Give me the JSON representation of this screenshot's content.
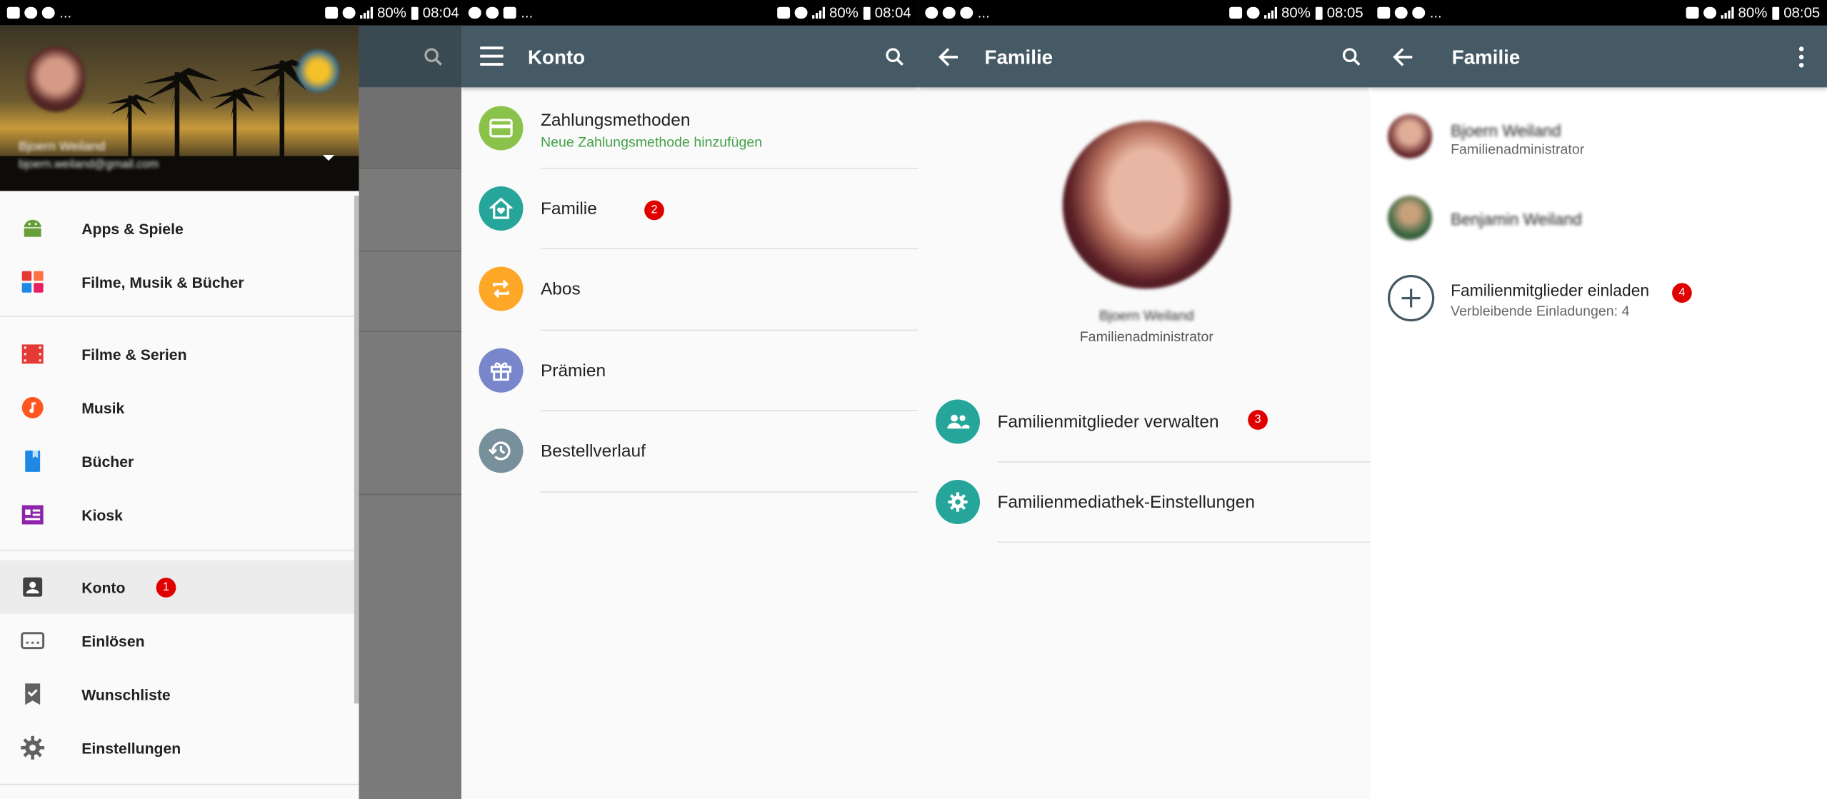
{
  "status_bars": [
    {
      "battery": "80%",
      "time": "08:04",
      "dots": "..."
    },
    {
      "battery": "80%",
      "time": "08:04",
      "dots": "..."
    },
    {
      "battery": "80%",
      "time": "08:05",
      "dots": "..."
    },
    {
      "battery": "80%",
      "time": "08:05",
      "dots": "..."
    }
  ],
  "drawer": {
    "user_name": "Bjoern Weiland",
    "user_email": "bjoern.weiland@gmail.com",
    "items": [
      {
        "label": "Apps & Spiele",
        "icon": "android-icon",
        "color": "#689f38"
      },
      {
        "label": "Filme, Musik & Bücher",
        "icon": "media-icon",
        "color": "#ef5350"
      },
      {
        "label": "Filme & Serien",
        "icon": "film-icon",
        "color": "#e53935"
      },
      {
        "label": "Musik",
        "icon": "music-icon",
        "color": "#ff5722"
      },
      {
        "label": "Bücher",
        "icon": "book-icon",
        "color": "#1e88e5"
      },
      {
        "label": "Kiosk",
        "icon": "kiosk-icon",
        "color": "#8e24aa"
      },
      {
        "label": "Konto",
        "icon": "account-icon",
        "color": "#424242",
        "selected": true,
        "badge": "1"
      },
      {
        "label": "Einlösen",
        "icon": "redeem-icon",
        "color": "#616161"
      },
      {
        "label": "Wunschliste",
        "icon": "wishlist-icon",
        "color": "#616161"
      },
      {
        "label": "Einstellungen",
        "icon": "settings-icon",
        "color": "#616161"
      }
    ]
  },
  "konto": {
    "title": "Konto",
    "items": [
      {
        "label": "Zahlungsmethoden",
        "sublabel": "Neue Zahlungsmethode hinzufügen",
        "icon": "card-icon",
        "color": "#8bc34a"
      },
      {
        "label": "Familie",
        "icon": "family-home-icon",
        "color": "#26a69a",
        "badge": "2"
      },
      {
        "label": "Abos",
        "icon": "subscription-icon",
        "color": "#ffa726"
      },
      {
        "label": "Prämien",
        "icon": "gift-icon",
        "color": "#7986cb"
      },
      {
        "label": "Bestellverlauf",
        "icon": "history-icon",
        "color": "#78909c"
      }
    ]
  },
  "familie": {
    "title": "Familie",
    "profile_name": "Bjoern Weiland",
    "profile_role": "Familienadministrator",
    "items": [
      {
        "label": "Familienmitglieder verwalten",
        "icon": "group-icon",
        "badge": "3"
      },
      {
        "label": "Familienmediathek-Einstellungen",
        "icon": "gear-icon"
      }
    ],
    "accent": "#26a69a"
  },
  "members": {
    "title": "Familie",
    "list": [
      {
        "name": "Bjoern Weiland",
        "role": "Familienadministrator"
      },
      {
        "name": "Benjamin Weiland",
        "role": ""
      }
    ],
    "invite_label": "Familienmitglieder einladen",
    "invite_sub": "Verbleibende Einladungen: 4",
    "invite_badge": "4"
  }
}
